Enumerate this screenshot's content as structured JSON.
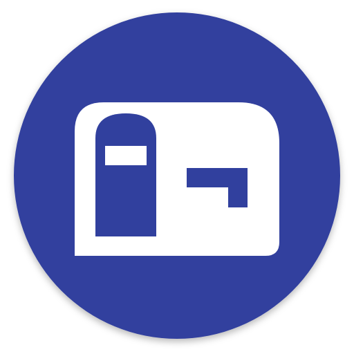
{
  "icon": {
    "name": "mailbox-icon",
    "colors": {
      "badge": "#31409E",
      "badge_shadow": "#1E2A6E",
      "mailbox_body": "#FFFFFF",
      "door": "#31409E",
      "flag": "#31409E",
      "slot": "#FFFFFF"
    }
  }
}
